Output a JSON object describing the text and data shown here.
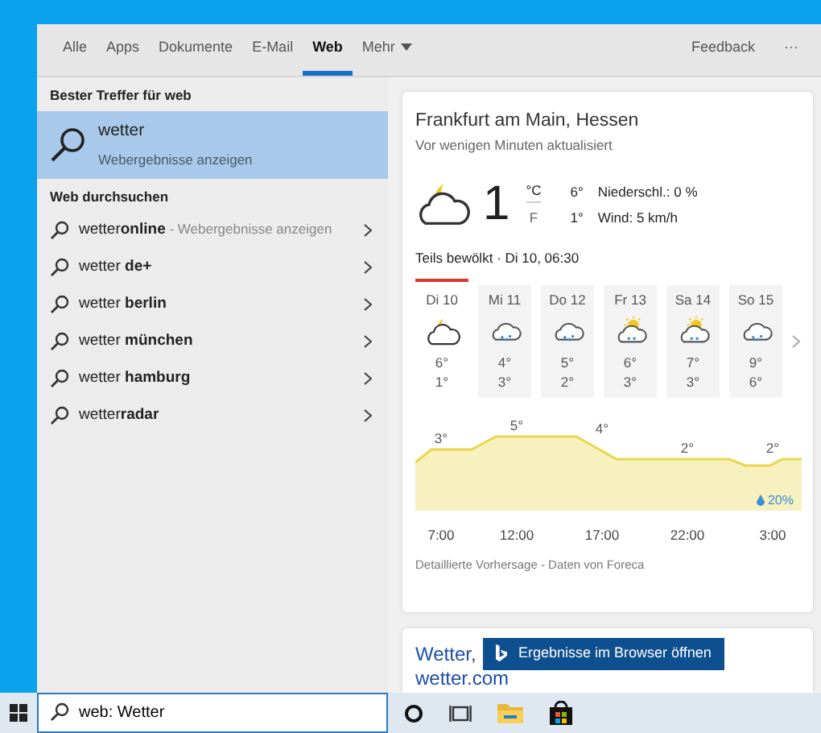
{
  "tabs": [
    {
      "label": "Alle",
      "selected": false
    },
    {
      "label": "Apps",
      "selected": false
    },
    {
      "label": "Dokumente",
      "selected": false
    },
    {
      "label": "E-Mail",
      "selected": false
    },
    {
      "label": "Web",
      "selected": true
    },
    {
      "label": "Mehr",
      "selected": false,
      "dropdown": true
    }
  ],
  "toolbar": {
    "feedback": "Feedback",
    "more": "···"
  },
  "best_match": {
    "heading": "Bester Treffer für web",
    "title": "wetter",
    "subtitle": "Webergebnisse anzeigen",
    "selected": true
  },
  "web_search": {
    "heading": "Web durchsuchen",
    "items": [
      {
        "text": "wetter**online**",
        "hint": "- Webergebnisse anzeigen"
      },
      {
        "text": "wetter **de+**"
      },
      {
        "text": "wetter **berlin**"
      },
      {
        "text": "wetter **münchen**"
      },
      {
        "text": "wetter **hamburg**"
      },
      {
        "text": "wetter**radar**"
      }
    ]
  },
  "weather": {
    "location": "Frankfurt am Main, Hessen",
    "updated": "Vor wenigen Minuten aktualisiert",
    "kind": "partly-cloudy-night",
    "temperature": "1",
    "unit_c": "°C",
    "unit_f": "F",
    "high": "6°",
    "low": "1°",
    "precipitation": "Niederschl.: 0 %",
    "wind": "Wind: 5 km/h",
    "condition": "Teils bewölkt · Di 10, 06:30",
    "days": [
      {
        "day": "Di 10",
        "kind": "partly-cloudy-night",
        "high": "6°",
        "low": "1°",
        "selected": true
      },
      {
        "day": "Mi 11",
        "kind": "rain",
        "high": "4°",
        "low": "3°",
        "selected": false
      },
      {
        "day": "Do 12",
        "kind": "rain",
        "high": "5°",
        "low": "2°",
        "selected": false
      },
      {
        "day": "Fr 13",
        "kind": "sun-rain",
        "high": "6°",
        "low": "3°",
        "selected": false
      },
      {
        "day": "Sa 14",
        "kind": "sun-rain",
        "high": "7°",
        "low": "3°",
        "selected": false
      },
      {
        "day": "So 15",
        "kind": "rain",
        "high": "9°",
        "low": "6°",
        "selected": false
      }
    ],
    "temperature_graph": {
      "times": [
        "7:00",
        "12:00",
        "17:00",
        "22:00",
        "3:00"
      ],
      "temperature_labels": [
        "3°",
        "5°",
        "4°",
        "2°",
        "2°"
      ]
    },
    "precip_chance": "20%",
    "footer": "Detaillierte Vorhersage - Daten von Foreca"
  },
  "result": {
    "title": "Wetter,",
    "url": "wetter.com"
  },
  "browser_button": "Ergebnisse im Browser öffnen",
  "taskbar": {
    "search": {
      "value": "web: Wetter"
    }
  }
}
